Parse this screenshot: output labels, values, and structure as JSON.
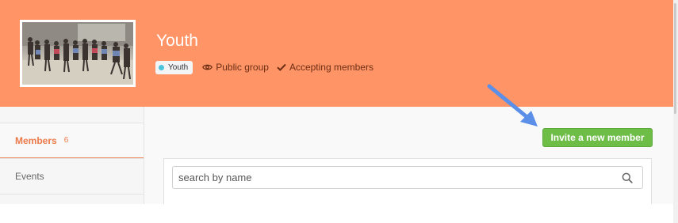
{
  "header": {
    "title": "Youth",
    "tag": {
      "label": "Youth",
      "dot_color": "#4cc4dc"
    },
    "visibility": {
      "label": "Public group",
      "icon": "eye-icon"
    },
    "membership": {
      "label": "Accepting members",
      "icon": "check-icon"
    },
    "banner_color": "#ff9466"
  },
  "sidebar": {
    "items": [
      {
        "label": "Members",
        "count": "6",
        "active": true
      },
      {
        "label": "Events",
        "count": "",
        "active": false
      }
    ]
  },
  "main": {
    "invite_button_label": "Invite a new member",
    "search": {
      "placeholder": "search by name",
      "value": "",
      "icon": "magnifier-icon"
    }
  },
  "colors": {
    "accent": "#ec7a4a",
    "button_green": "#6dbd47",
    "arrow_blue": "#5b8fe8"
  }
}
